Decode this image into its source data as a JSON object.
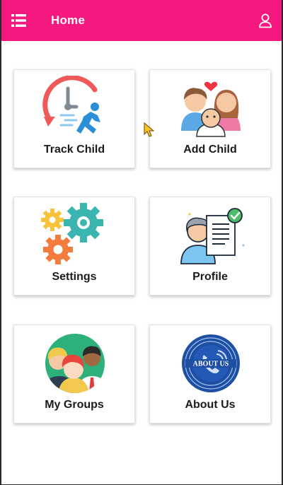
{
  "header": {
    "title": "Home",
    "background": "#f5187f",
    "menu_icon": "list-menu-icon",
    "user_icon": "user-account-icon"
  },
  "tiles": [
    {
      "label": "Track Child",
      "icon": "track-child-icon"
    },
    {
      "label": "Add Child",
      "icon": "family-icon"
    },
    {
      "label": "Settings",
      "icon": "gears-icon"
    },
    {
      "label": "Profile",
      "icon": "profile-document-icon"
    },
    {
      "label": "My Groups",
      "icon": "group-people-icon"
    },
    {
      "label": "About Us",
      "icon": "about-us-seal-icon"
    }
  ],
  "about_badge_text": "ABOUT US"
}
